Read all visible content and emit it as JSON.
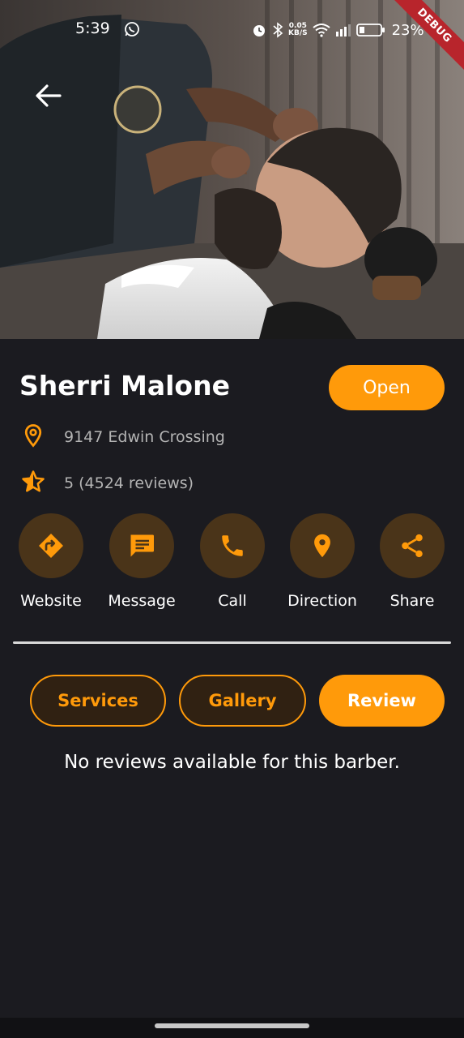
{
  "status_bar": {
    "time": "5:39",
    "speed_value": "0.05",
    "speed_unit": "KB/S",
    "battery": "23%",
    "icons": [
      "whatsapp-icon",
      "alarm-icon",
      "bluetooth-icon",
      "wifi-icon",
      "signal-icon",
      "battery-icon"
    ]
  },
  "debug_banner": "DEBUG",
  "barber": {
    "name": "Sherri Malone",
    "status": "Open",
    "address": "9147 Edwin Crossing",
    "rating_text": "5 (4524 reviews)"
  },
  "actions": [
    {
      "label": "Website",
      "icon": "website-forward-icon"
    },
    {
      "label": "Message",
      "icon": "message-icon"
    },
    {
      "label": "Call",
      "icon": "phone-icon"
    },
    {
      "label": "Direction",
      "icon": "location-pin-icon"
    },
    {
      "label": "Share",
      "icon": "share-icon"
    }
  ],
  "tabs": [
    {
      "label": "Services",
      "active": false
    },
    {
      "label": "Gallery",
      "active": false
    },
    {
      "label": "Review",
      "active": true
    }
  ],
  "review_empty_message": "No reviews available for this barber.",
  "colors": {
    "accent": "#ff9a0a",
    "background": "#1b1b20",
    "action_circle": "#4a3419",
    "muted_text": "#b4b4b4"
  }
}
